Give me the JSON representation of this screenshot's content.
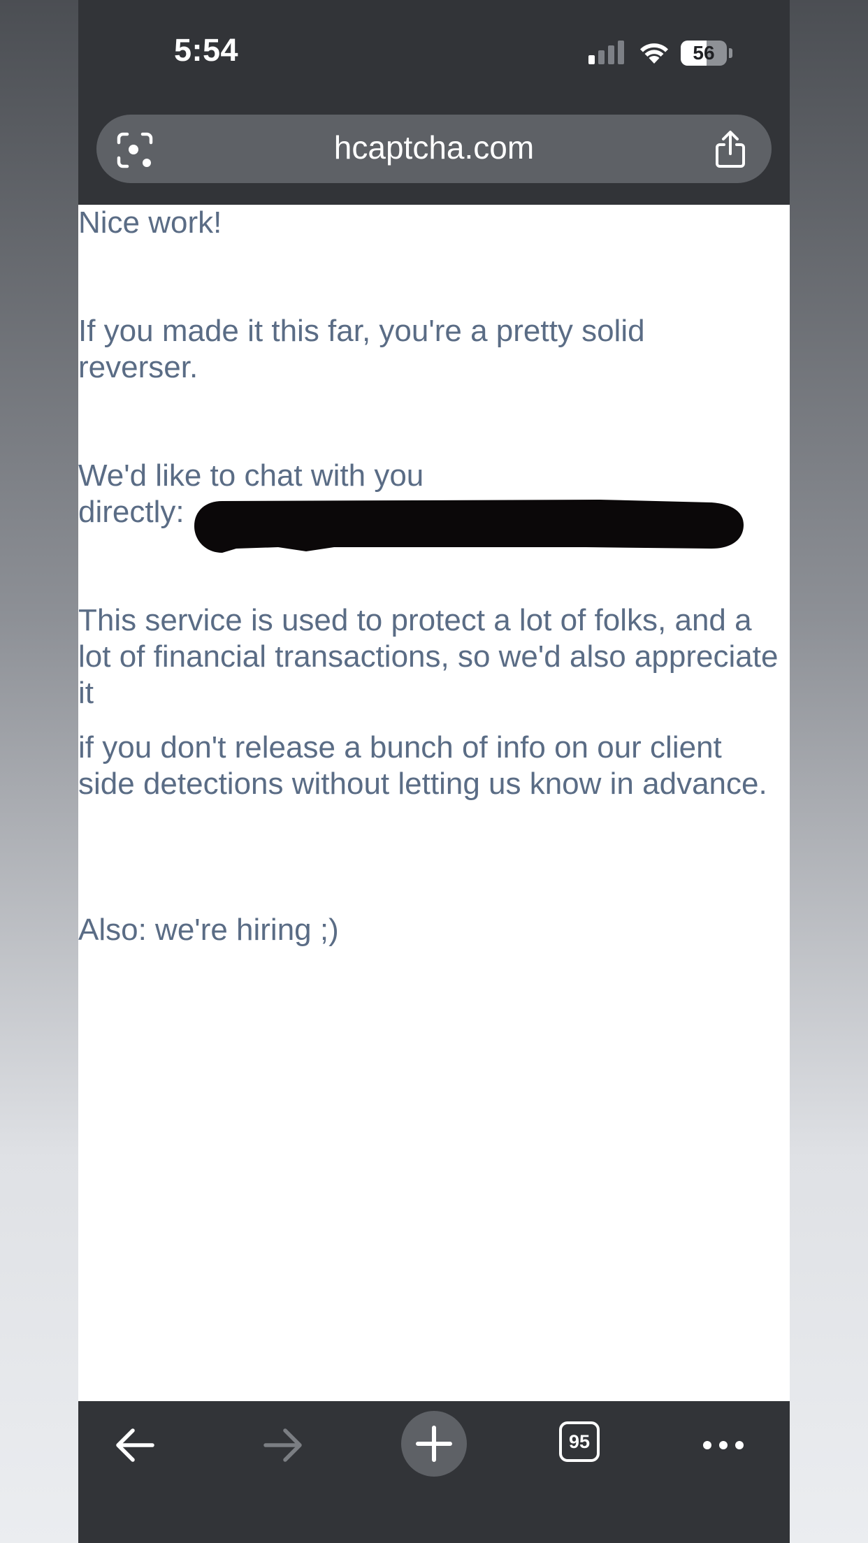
{
  "status_bar": {
    "time": "5:54",
    "battery": "56",
    "battery_level": 0.56,
    "signal_icon": "cellular-signal-icon",
    "wifi_icon": "wifi-icon"
  },
  "address_bar": {
    "url": "hcaptcha.com",
    "left_icon": "lens-icon",
    "right_icon": "share-icon"
  },
  "content": {
    "heading": "Nice work!",
    "paragraph_reverser": "If you made it this far, you're a pretty solid reverser.",
    "paragraph_chat": "We'd like to chat with you directly:",
    "paragraph_service": "This service is used to protect a lot of folks, and a lot of financial transactions, so we'd also appreciate it",
    "paragraph_detections": "if you don't release a bunch of info on our client side detections without letting us know in advance.",
    "paragraph_hiring": "Also: we're hiring ;)"
  },
  "toolbar": {
    "back_icon": "back-arrow-icon",
    "forward_icon": "forward-arrow-icon",
    "new_tab_icon": "plus-icon",
    "tab_count": "95",
    "menu_icon": "more-dots-icon"
  },
  "colors": {
    "chrome_background": "#323438",
    "address_bar": "#5e6166",
    "body_text": "#5a6c85",
    "page_background": "#ffffff"
  }
}
